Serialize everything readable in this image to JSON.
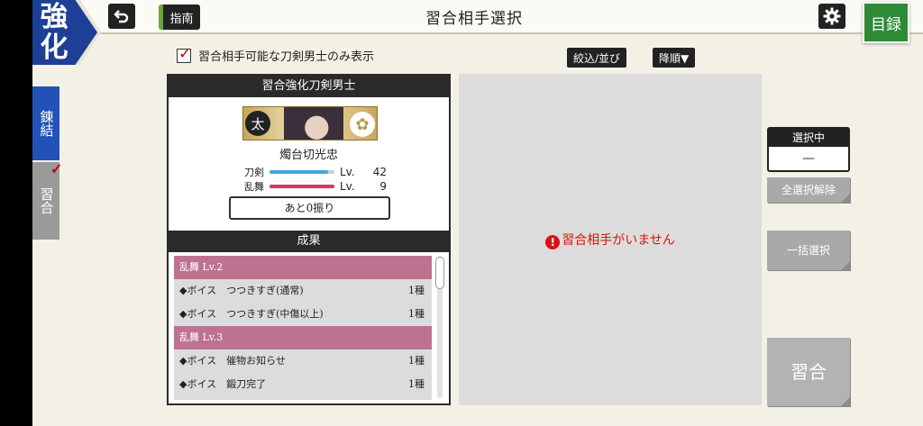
{
  "header": {
    "section_tab": "強化",
    "back_icon": "back-arrow-icon",
    "guide_label": "指南",
    "title": "習合相手選択",
    "settings_icon": "gear-icon",
    "catalog_label": "目録"
  },
  "side_tabs": {
    "link_label": "錬結",
    "practice_label": "習合",
    "practice_check_icon": "checkmark-icon"
  },
  "filter": {
    "checkbox_checked": true,
    "checkbox_label": "習合相手可能な刀剣男士のみ表示",
    "filter_sort_label": "絞込/並び",
    "order_label": "降順▼"
  },
  "target": {
    "header": "習合強化刀剣男士",
    "badge": "太",
    "name": "燭台切光忠",
    "stats": [
      {
        "label": "刀剣",
        "lv_label": "Lv.",
        "value": "42",
        "fill": 0.9,
        "color": "#3fa9de"
      },
      {
        "label": "乱舞",
        "lv_label": "Lv.",
        "value": "9",
        "fill": 1.0,
        "color": "#d8355f"
      }
    ],
    "remaining": "あと0振り"
  },
  "results": {
    "header": "成果",
    "groups": [
      {
        "title": "乱舞 Lv.2",
        "items": [
          {
            "text": "◆ボイス　つつきすぎ(通常)",
            "count": "1種"
          },
          {
            "text": "◆ボイス　つつきすぎ(中傷以上)",
            "count": "1種"
          }
        ]
      },
      {
        "title": "乱舞 Lv.3",
        "items": [
          {
            "text": "◆ボイス　催物お知らせ",
            "count": "1種"
          },
          {
            "text": "◆ボイス　鍛刀完了",
            "count": "1種"
          }
        ]
      }
    ]
  },
  "partner_area": {
    "message": "習合相手がいません"
  },
  "right_panel": {
    "selected_header": "選択中",
    "selected_value": "—",
    "deselect_all": "全選択解除",
    "bulk_select": "一括選択",
    "fuse_button": "習合"
  }
}
